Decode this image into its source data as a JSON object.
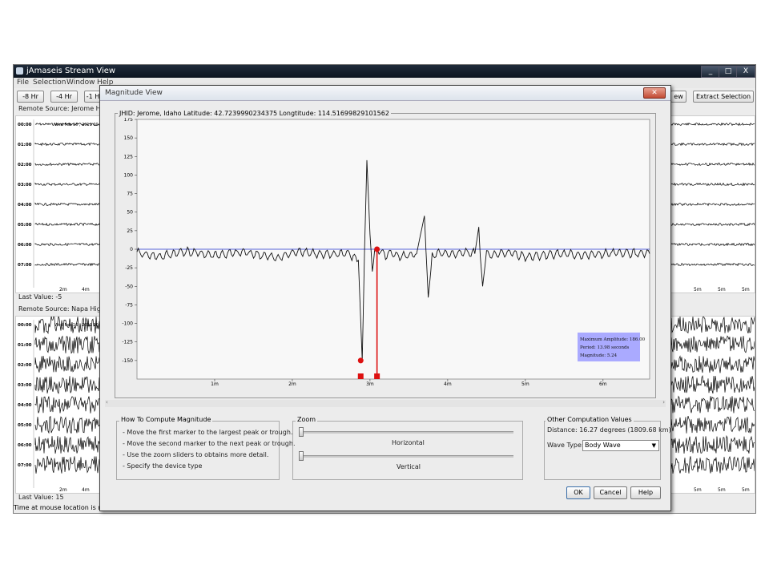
{
  "main_window": {
    "title": "jAmaseis Stream View",
    "controls": [
      "_",
      "□",
      "X"
    ],
    "menu": [
      "File",
      "Selection",
      "Window",
      "Help"
    ],
    "toolbar": {
      "left_buttons": [
        "-8 Hr",
        "-4 Hr",
        "-1 H"
      ],
      "right_buttons": [
        "ew",
        "Extract Selection"
      ]
    },
    "sections": [
      {
        "source": "Remote Source: Jerome High",
        "last_value": "Last Value:  -5",
        "date_tag": "Wed Feb 16 , 2011 00:00:0"
      },
      {
        "source": "Remote Source: Napa High S",
        "last_value": "Last Value:  15",
        "date_tag": "Wed Feb 16 , 2011 00:00:0"
      }
    ],
    "time_labels": [
      "00:00",
      "01:00",
      "02:00",
      "03:00",
      "04:00",
      "05:00",
      "06:00",
      "07:00"
    ],
    "axis_ticks_left": [
      "2m",
      "4m"
    ],
    "axis_ticks_right": [
      "5m",
      "5m",
      "5m"
    ],
    "status": "Time at mouse location is not a"
  },
  "dialog": {
    "title": "Magnitude View",
    "close_symbol": "✕",
    "plot_caption": "JHID: Jerome, Idaho Latitude: 42.7239990234375 Longtitude: 114.51699829101562",
    "info_box": [
      "Maximum Amplitude: 186.00",
      "Period: 13.98 seconds",
      "Magnitude: 5.24"
    ],
    "how_to": {
      "title": "How To Compute Magnitude",
      "steps": [
        "- Move the first marker to the largest peak or trough.",
        "- Move the second marker to the next peak or trough.",
        "- Use the zoom sliders to obtains more detail.",
        "- Specify the device type"
      ]
    },
    "zoom": {
      "title": "Zoom",
      "horizontal": "Horizontal",
      "vertical": "Vertical",
      "horizontal_value": 0.0,
      "vertical_value": 0.0
    },
    "other": {
      "title": "Other Computation Values",
      "distance": "Distance: 16.27 degrees (1809.68 km)",
      "wave_type_label": "Wave Type:",
      "wave_type_value": "Body Wave"
    },
    "buttons": {
      "ok": "OK",
      "cancel": "Cancel",
      "help": "Help"
    }
  },
  "chart_data": {
    "type": "line",
    "title": "",
    "xlabel": "",
    "ylabel": "",
    "y_ticks": [
      175,
      150,
      125,
      100,
      75,
      50,
      25,
      0,
      -25,
      -50,
      -75,
      -100,
      -125,
      -150
    ],
    "x_ticks": [
      "1m",
      "2m",
      "3m",
      "4m",
      "5m",
      "6m"
    ],
    "ylim": [
      -175,
      175
    ],
    "xlim": [
      0,
      6.6
    ],
    "baseline": 0,
    "series": [
      {
        "x": [
          0,
          0.3,
          0.6,
          1.0,
          1.4,
          1.8,
          2.1,
          2.4,
          2.7,
          2.85,
          2.9,
          2.93,
          2.96,
          3.0,
          3.03,
          3.06,
          3.1,
          3.2,
          3.3,
          3.4,
          3.6,
          3.7,
          3.72,
          3.75,
          3.8,
          3.9,
          4.0,
          4.2,
          4.35,
          4.4,
          4.42,
          4.45,
          4.5,
          4.6,
          4.8,
          5.0,
          5.4,
          5.8,
          6.2,
          6.6
        ],
        "y": [
          -5,
          -10,
          -3,
          -8,
          -4,
          -12,
          -2,
          -8,
          -5,
          -15,
          -150,
          0,
          120,
          20,
          -30,
          -5,
          0,
          -8,
          -5,
          -10,
          -6,
          45,
          0,
          -65,
          -10,
          -5,
          -8,
          -4,
          -6,
          30,
          -10,
          -50,
          -5,
          -8,
          -4,
          -10,
          -6,
          -8,
          -5,
          -6
        ]
      }
    ],
    "markers": [
      {
        "name": "first",
        "x": 2.88,
        "y": -150
      },
      {
        "name": "second",
        "x": 3.09,
        "y": 0
      }
    ]
  }
}
